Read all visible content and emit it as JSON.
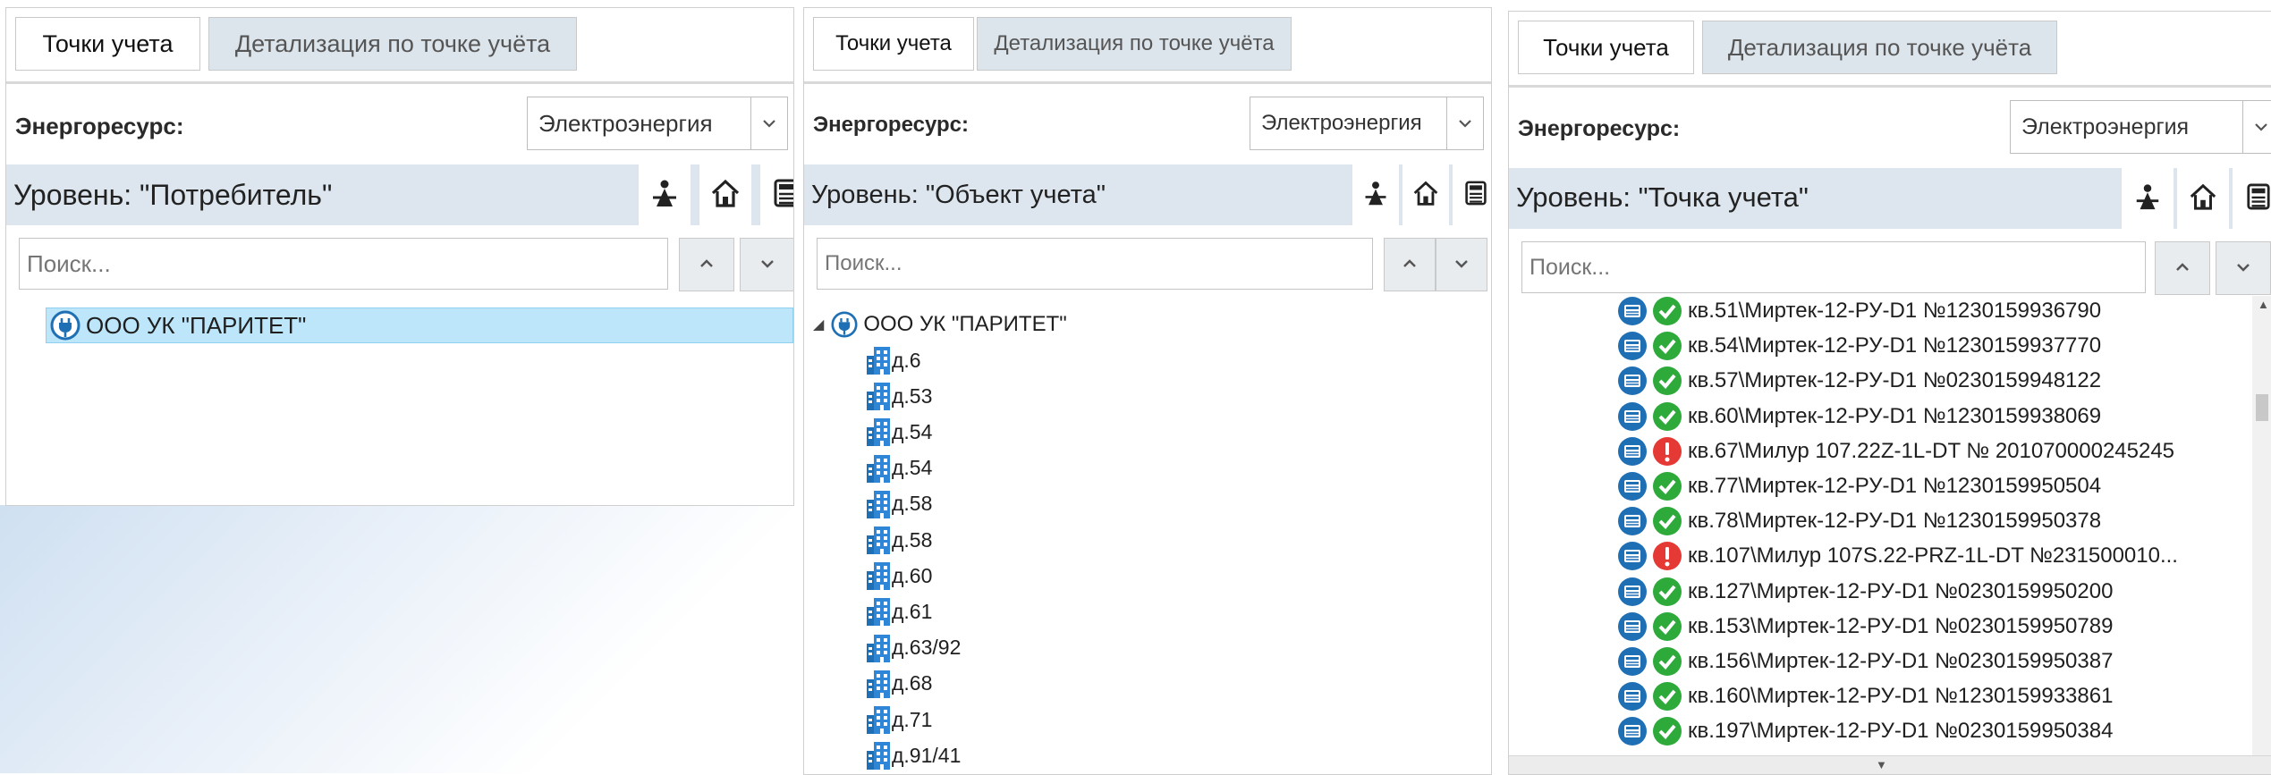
{
  "panels": [
    {
      "tabs": {
        "active": "Точки учета",
        "inactive": "Детализация по точке учёта"
      },
      "resource_label": "Энергоресурс:",
      "resource_value": "Электроэнергия",
      "level_title": "Уровень: \"Потребитель\"",
      "search_placeholder": "Поиск...",
      "tree": [
        {
          "label": "ООО УК \"ПАРИТЕТ\"",
          "icon": "consumer-plug-icon",
          "selected": true
        }
      ]
    },
    {
      "tabs": {
        "active": "Точки учета",
        "inactive": "Детализация по точке учёта"
      },
      "resource_label": "Энергоресурс:",
      "resource_value": "Электроэнергия",
      "level_title": "Уровень: \"Объект учета\"",
      "search_placeholder": "Поиск...",
      "tree_root": "ООО УК \"ПАРИТЕТ\"",
      "tree": [
        "д.6",
        "д.53",
        "д.54",
        "д.54",
        "д.58",
        "д.58",
        "д.60",
        "д.61",
        "д.63/92",
        "д.68",
        "д.71",
        "д.91/41"
      ]
    },
    {
      "tabs": {
        "active": "Точки учета",
        "inactive": "Детализация по точке учёта"
      },
      "resource_label": "Энергоресурс:",
      "resource_value": "Электроэнергия",
      "level_title": "Уровень: \"Точка учета\"",
      "search_placeholder": "Поиск...",
      "tree": [
        {
          "label": "кв.51\\Миртек-12-РУ-D1 №1230159936790",
          "status": "ok"
        },
        {
          "label": "кв.54\\Миртек-12-РУ-D1 №1230159937770",
          "status": "ok"
        },
        {
          "label": "кв.57\\Миртек-12-РУ-D1 №0230159948122",
          "status": "ok"
        },
        {
          "label": "кв.60\\Миртек-12-РУ-D1 №1230159938069",
          "status": "ok"
        },
        {
          "label": "кв.67\\Милур 107.22Z-1L-DT № 201070000245245",
          "status": "error"
        },
        {
          "label": "кв.77\\Миртек-12-РУ-D1 №1230159950504",
          "status": "ok"
        },
        {
          "label": "кв.78\\Миртек-12-РУ-D1 №1230159950378",
          "status": "ok"
        },
        {
          "label": "кв.107\\Милур 107S.22-PRZ-1L-DT №231500010...",
          "status": "error"
        },
        {
          "label": "кв.127\\Миртек-12-РУ-D1 №0230159950200",
          "status": "ok"
        },
        {
          "label": "кв.153\\Миртек-12-РУ-D1 №0230159950789",
          "status": "ok"
        },
        {
          "label": "кв.156\\Миртек-12-РУ-D1 №0230159950387",
          "status": "ok"
        },
        {
          "label": "кв.160\\Миртек-12-РУ-D1 №1230159933861",
          "status": "ok"
        },
        {
          "label": "кв.197\\Миртек-12-РУ-D1 №0230159950384",
          "status": "ok"
        }
      ]
    }
  ],
  "colors": {
    "ok": "#2eaa3b",
    "error": "#e53935",
    "meter": "#1f6fb5",
    "level_bg": "#dde6ee",
    "selected": "#bde6fb"
  }
}
